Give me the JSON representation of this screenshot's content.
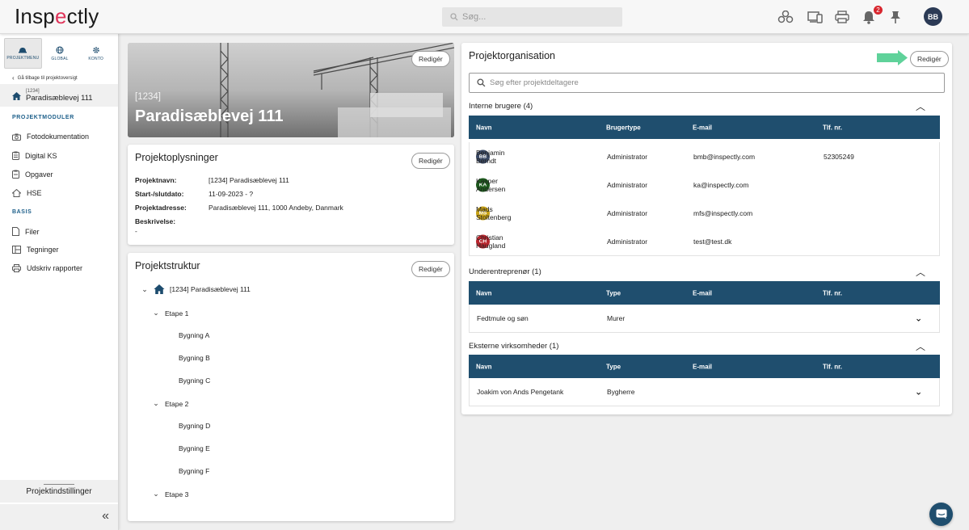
{
  "header": {
    "logo_pre": "Insp",
    "logo_accent": "e",
    "logo_post": "ctly",
    "search_placeholder": "Søg...",
    "notification_count": "2",
    "user_initials": "BB"
  },
  "sidebar": {
    "tabs": [
      {
        "label": "PROJEKTMENU",
        "icon": "project-icon",
        "active": true
      },
      {
        "label": "GLOBAL",
        "icon": "globe-icon"
      },
      {
        "label": "KONTO",
        "icon": "gear-icon"
      }
    ],
    "back_label": "Gå tilbage til projektoversigt",
    "project_code": "[1234]",
    "project_name": "Paradisæblevej 111",
    "section_modules": "PROJEKTMODULER",
    "modules": [
      {
        "label": "Fotodokumentation",
        "icon": "camera-icon"
      },
      {
        "label": "Digital KS",
        "icon": "clipboard-icon"
      },
      {
        "label": "Opgaver",
        "icon": "tasks-icon"
      },
      {
        "label": "HSE",
        "icon": "shield-icon"
      }
    ],
    "section_basis": "BASIS",
    "basis": [
      {
        "label": "Filer",
        "icon": "file-icon"
      },
      {
        "label": "Tegninger",
        "icon": "drawing-icon"
      },
      {
        "label": "Udskriv rapporter",
        "icon": "print-icon"
      }
    ],
    "settings_label": "Projektindstillinger",
    "collapse_label": "«"
  },
  "hero": {
    "code": "[1234]",
    "title": "Paradisæblevej 111",
    "edit_label": "Redigér"
  },
  "info": {
    "title": "Projektoplysninger",
    "edit_label": "Redigér",
    "rows": [
      {
        "label": "Projektnavn:",
        "value": "[1234] Paradisæblevej 111"
      },
      {
        "label": "Start-/slutdato:",
        "value": "11-09-2023 - ?"
      },
      {
        "label": "Projektadresse:",
        "value": "Paradisæblevej 111, 1000 Andeby, Danmark"
      },
      {
        "label": "Beskrivelse:",
        "value": ""
      }
    ],
    "description_value": "-"
  },
  "structure": {
    "title": "Projektstruktur",
    "edit_label": "Redigér",
    "root": "[1234] Paradisæblevej 111",
    "nodes": [
      {
        "label": "Etape 1",
        "level": 1
      },
      {
        "label": "Bygning A",
        "level": 2
      },
      {
        "label": "Bygning B",
        "level": 2
      },
      {
        "label": "Bygning C",
        "level": 2
      },
      {
        "label": "Etape 2",
        "level": 1
      },
      {
        "label": "Bygning D",
        "level": 2
      },
      {
        "label": "Bygning E",
        "level": 2
      },
      {
        "label": "Bygning F",
        "level": 2
      },
      {
        "label": "Etape 3",
        "level": 1
      }
    ]
  },
  "org": {
    "title": "Projektorganisation",
    "edit_label": "Redigér",
    "search_placeholder": "Søg efter projektdeltagere",
    "internal": {
      "title": "Interne brugere (4)",
      "headers": [
        "Navn",
        "Brugertype",
        "E-mail",
        "Tlf. nr."
      ],
      "rows": [
        {
          "initials": "BB",
          "color": "#3b4a66",
          "name": "Benjamin Berndt",
          "type": "Administrator",
          "email": "bmb@inspectly.com",
          "phone": "52305249"
        },
        {
          "initials": "KA",
          "color": "#1d5a1d",
          "name": "Kasper Andersen",
          "type": "Administrator",
          "email": "ka@inspectly.com",
          "phone": ""
        },
        {
          "initials": "MS",
          "color": "#c8a216",
          "name": "Mads Stoltenberg",
          "type": "Administrator",
          "email": "mfs@inspectly.com",
          "phone": ""
        },
        {
          "initials": "CH",
          "color": "#b8262e",
          "name": "Christian Haugland",
          "type": "Administrator",
          "email": "test@test.dk",
          "phone": ""
        }
      ]
    },
    "sub": {
      "title": "Underentreprenør (1)",
      "headers": [
        "Navn",
        "Type",
        "E-mail",
        "Tlf. nr."
      ],
      "rows": [
        {
          "name": "Fedtmule og søn",
          "type": "Murer"
        }
      ]
    },
    "external": {
      "title": "Eksterne virksomheder (1)",
      "headers": [
        "Navn",
        "Type",
        "E-mail",
        "Tlf. nr."
      ],
      "rows": [
        {
          "name": "Joakim von Ands Pengetank",
          "type": "Bygherre"
        }
      ]
    }
  }
}
